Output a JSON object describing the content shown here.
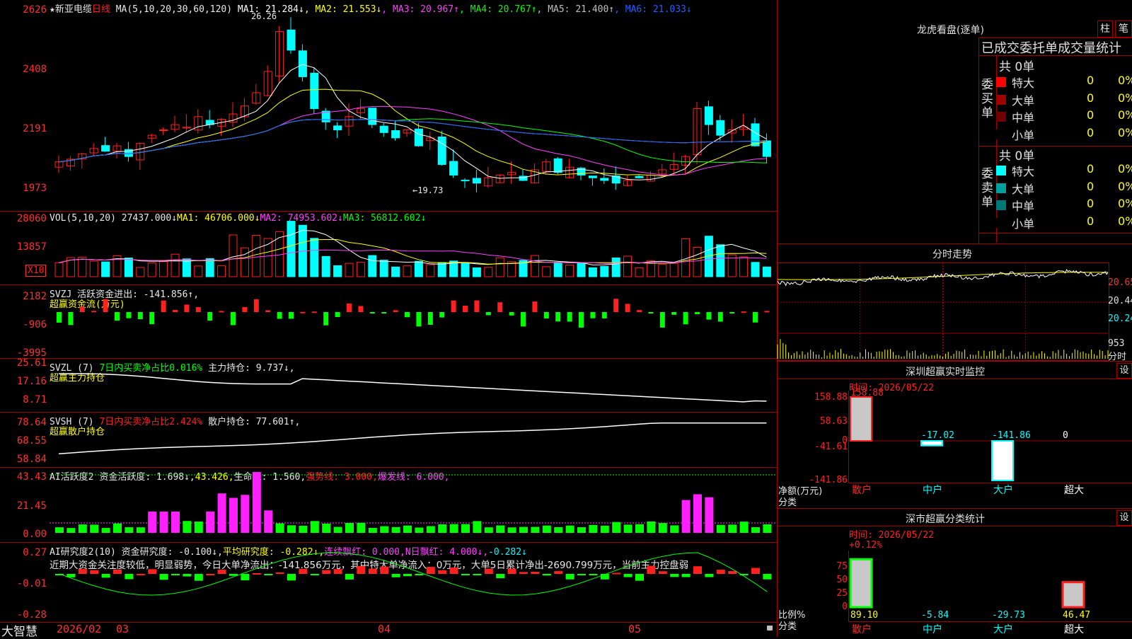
{
  "main_chart": {
    "star": "★",
    "stock_name": "新亚电缆",
    "period": "日线",
    "ma_params": "MA(5,10,20,30,60,120)",
    "ma_values": [
      {
        "label": "MA1: 21.284↓",
        "color": "#ffffff"
      },
      {
        "label": "MA2: 21.553↓",
        "color": "#ffff00"
      },
      {
        "label": "MA3: 20.967↑",
        "color": "#ff40ff"
      },
      {
        "label": "MA4: 20.767↑",
        "color": "#00ff00"
      },
      {
        "label": "MA5: 21.400↑",
        "color": "#c0c0c0"
      },
      {
        "label": "MA6: 21.033↓",
        "color": "#2060ff"
      }
    ],
    "y_labels": [
      "2626",
      "2408",
      "2191",
      "1973"
    ],
    "high_annotation": "26.26",
    "low_annotation": "←19.73"
  },
  "volume": {
    "header": "VOL(5,10,20)",
    "value": "27437.000↓",
    "ma1": "MA1: 46706.000↓",
    "ma2": "MA2: 74953.602↓",
    "ma3": "MA3: 56812.602↓",
    "y_labels": [
      "28060",
      "13857"
    ],
    "unit": "X10"
  },
  "svzj": {
    "header": "SVZJ  活跃资金进出: -141.856↑,",
    "sub": "超赢资金流(万元)",
    "y_labels": [
      "2182",
      "-906",
      "-3995"
    ]
  },
  "svzl": {
    "header": "SVZL (7)",
    "ratio": "7日内买卖净占比0.016%",
    "hold": "主力持仓: 9.737↓,",
    "sub": "超赢主力持仓",
    "y_labels": [
      "25.61",
      "17.16",
      "8.71"
    ]
  },
  "svsh": {
    "header": "SVSH (7)",
    "ratio": "7日内买卖净占比2.424%",
    "hold": "散户持仓: 77.601↑,",
    "sub": "超赢散户持仓",
    "y_labels": [
      "78.64",
      "68.55",
      "58.84"
    ]
  },
  "ai_active": {
    "header": "AI活跃度2",
    "fund": "资金活跃度: 1.698↓,",
    "v2": "43.426,",
    "life": "生命线: 1.560,",
    "strong": "强势线: 3.000,",
    "burst": "爆发线: 6.000,",
    "y_labels": [
      "43.43",
      "21.45",
      "0.00"
    ]
  },
  "ai_research": {
    "header": "AI研究度2(10)",
    "fund": "资金研究度: -0.100↓,",
    "avg": "平均研究度: -0.282↓,",
    "lian": "连续飘红: 0.000,",
    "nday": "N日飘红: 4.000↓,",
    "last": "-0.282↓",
    "comment": "近期大资金关注度较低，明显弱势，今日大单净流出：-141.856万元，其中特大单净流入：0万元，大单5日累计净出-2690.799万元，当前主力控盘弱",
    "y_labels": [
      "0.27",
      "-0.01",
      "-0.28"
    ]
  },
  "date_axis": [
    "2026/02",
    "03",
    "04",
    "05"
  ],
  "brand": "大智慧",
  "dragon_tiger": {
    "title": "龙虎看盘(逐单)",
    "btn_zhu": "柱",
    "btn_bi": "笔",
    "subtitle": "已成交委托单成交量统计",
    "buy_label": "委买单",
    "sell_label": "委卖单",
    "buy_total": "共 0单",
    "sell_total": "共 0单",
    "buy_rows": [
      {
        "label": "特大",
        "num": "0",
        "pct": "0%",
        "color": "#ff0000"
      },
      {
        "label": "大单",
        "num": "0",
        "pct": "0%",
        "color": "#a00000"
      },
      {
        "label": "中单",
        "num": "0",
        "pct": "0%",
        "color": "#700000"
      },
      {
        "label": "小单",
        "num": "0",
        "pct": "0%",
        "color": "#000000"
      }
    ],
    "sell_rows": [
      {
        "label": "特大",
        "num": "0",
        "pct": "0%",
        "color": "#00ffff"
      },
      {
        "label": "大单",
        "num": "0",
        "pct": "0%",
        "color": "#00a0a0"
      },
      {
        "label": "中单",
        "num": "0",
        "pct": "0%",
        "color": "#007878"
      },
      {
        "label": "小单",
        "num": "0",
        "pct": "0%",
        "color": "#000000"
      }
    ]
  },
  "intraday": {
    "title": "分时走势",
    "price_labels": [
      "20.65",
      "20.44",
      "20.24"
    ],
    "vol_label": "953",
    "time_label": "分时"
  },
  "sz_monitor": {
    "title": "深圳超赢实时监控",
    "set_btn": "设",
    "time": "时间: 2026/05/22",
    "y_labels": [
      "158.88",
      "58.63",
      "0",
      "-41.61",
      "-141.86"
    ],
    "unit_label": "净额(万元)",
    "class_label": "分类",
    "bars": [
      {
        "category": "散户",
        "value": 158.88,
        "label": "158.88"
      },
      {
        "category": "中户",
        "value": -17.02,
        "label": "-17.02"
      },
      {
        "category": "大户",
        "value": -141.86,
        "label": "-141.86"
      },
      {
        "category": "超大",
        "value": 0,
        "label": "0"
      }
    ]
  },
  "sz_class": {
    "title": "深市超赢分类统计",
    "set_btn": "设",
    "time": "时间: 2026/05/22",
    "top_pct": "+0.12%",
    "y_labels": [
      "75",
      "50",
      "25",
      "0"
    ],
    "ratio_label": "比例%",
    "class_label": "分类",
    "bars": [
      {
        "category": "散户",
        "value": 89.1,
        "label": "89.10"
      },
      {
        "category": "中户",
        "value": -5.84,
        "label": "-5.84"
      },
      {
        "category": "大户",
        "value": -29.73,
        "label": "-29.73"
      },
      {
        "category": "超大",
        "value": 46.47,
        "label": "46.47"
      }
    ]
  },
  "colors": {
    "up": "#ff2020",
    "down": "#00ffff",
    "border": "#a00000",
    "axis_text": "#ff3030"
  }
}
